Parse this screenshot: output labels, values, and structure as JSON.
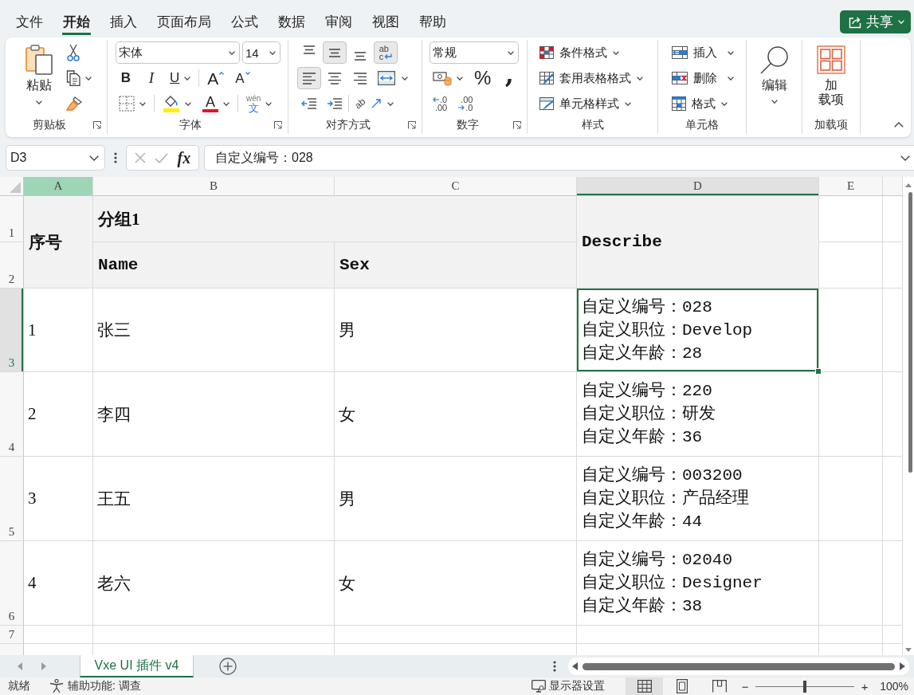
{
  "menu_tabs": [
    {
      "label": "文件",
      "selected": false
    },
    {
      "label": "开始",
      "selected": true
    },
    {
      "label": "插入",
      "selected": false
    },
    {
      "label": "页面布局",
      "selected": false
    },
    {
      "label": "公式",
      "selected": false
    },
    {
      "label": "数据",
      "selected": false
    },
    {
      "label": "审阅",
      "selected": false
    },
    {
      "label": "视图",
      "selected": false
    },
    {
      "label": "帮助",
      "selected": false
    }
  ],
  "share_button": {
    "label": "共享"
  },
  "ribbon": {
    "clipboard": {
      "paste": "粘贴",
      "group_label": "剪贴板"
    },
    "font": {
      "font_name": "宋体",
      "font_size": "14",
      "bold": "B",
      "italic": "I",
      "underline": "U",
      "grow": "A",
      "shrink": "A",
      "font_color": "A",
      "phonetic_top": "wén",
      "phonetic_bottom": "文",
      "group_label": "字体"
    },
    "alignment": {
      "buttons": [
        {
          "kind": "top",
          "selected": false
        },
        {
          "kind": "middle",
          "selected": true
        },
        {
          "kind": "bottom",
          "selected": false
        },
        {
          "kind": "wrap",
          "selected": true,
          "glyph": [
            "ab",
            "c"
          ]
        },
        {
          "kind": "left",
          "selected": true
        },
        {
          "kind": "center",
          "selected": false
        },
        {
          "kind": "right",
          "selected": false
        },
        {
          "kind": "merge",
          "selected": false
        },
        {
          "kind": "outdent",
          "selected": false
        },
        {
          "kind": "indent",
          "selected": false
        },
        {
          "kind": "orientation",
          "selected": false,
          "glyph": [
            "ab"
          ]
        }
      ],
      "group_label": "对齐方式"
    },
    "number": {
      "format": "常规",
      "percent": "%",
      "comma": ",",
      "increase_decimal": [
        ".0",
        ".00"
      ],
      "decrease_decimal": [
        ".00",
        ".0"
      ],
      "group_label": "数字"
    },
    "styles": {
      "items": [
        {
          "kind": "conditional",
          "label": "条件格式"
        },
        {
          "kind": "table",
          "label": "套用表格格式"
        },
        {
          "kind": "cell",
          "label": "单元格样式"
        }
      ],
      "group_label": "样式"
    },
    "cells": {
      "items": [
        {
          "kind": "insert",
          "label": "插入"
        },
        {
          "kind": "delete",
          "label": "删除"
        },
        {
          "kind": "format",
          "label": "格式"
        }
      ],
      "group_label": "单元格"
    },
    "editing": {
      "label": "编辑"
    },
    "addins": {
      "label_lines": [
        "加",
        "载项"
      ],
      "group_label": "加载项"
    }
  },
  "formula_bar": {
    "name_box": "D3",
    "function_label": "fx",
    "formula": "自定义编号：028"
  },
  "sheet": {
    "columns": [
      {
        "label": "A",
        "selected": true,
        "active": false
      },
      {
        "label": "B",
        "selected": false,
        "active": false
      },
      {
        "label": "C",
        "selected": false,
        "active": false
      },
      {
        "label": "D",
        "selected": false,
        "active": true
      },
      {
        "label": "E",
        "selected": false,
        "active": false
      }
    ],
    "rows": [
      {
        "label": "1",
        "active": false
      },
      {
        "label": "2",
        "active": false
      },
      {
        "label": "3",
        "active": true
      },
      {
        "label": "4",
        "active": false
      },
      {
        "label": "5",
        "active": false
      },
      {
        "label": "6",
        "active": false
      },
      {
        "label": "7",
        "active": false
      }
    ],
    "header": {
      "seq": "序号",
      "group": "分组1",
      "name": "Name",
      "sex": "Sex",
      "describe": "Describe"
    },
    "records": [
      {
        "seq": "1",
        "name": "张三",
        "sex": "男",
        "describe": [
          "自定义编号：028",
          "自定义职位：Develop",
          "自定义年龄：28"
        ],
        "selected": true
      },
      {
        "seq": "2",
        "name": "李四",
        "sex": "女",
        "describe": [
          "自定义编号：220",
          "自定义职位：研发",
          "自定义年龄：36"
        ],
        "selected": false
      },
      {
        "seq": "3",
        "name": "王五",
        "sex": "男",
        "describe": [
          "自定义编号：003200",
          "自定义职位：产品经理",
          "自定义年龄：44"
        ],
        "selected": false
      },
      {
        "seq": "4",
        "name": "老六",
        "sex": "女",
        "describe": [
          "自定义编号：02040",
          "自定义职位：Designer",
          "自定义年龄：38"
        ],
        "selected": false
      }
    ]
  },
  "sheet_tabs": [
    {
      "label": "Vxe UI 插件 v4",
      "selected": true
    }
  ],
  "status_bar": {
    "ready": "就绪",
    "accessibility": "辅助功能: 调查",
    "display_settings": "显示器设置",
    "views": [
      {
        "kind": "normal",
        "selected": true
      },
      {
        "kind": "layout",
        "selected": false
      },
      {
        "kind": "pagebreak",
        "selected": false
      }
    ],
    "zoom": {
      "minus": "−",
      "plus": "+",
      "level": 0.5,
      "percent": "100%"
    }
  }
}
